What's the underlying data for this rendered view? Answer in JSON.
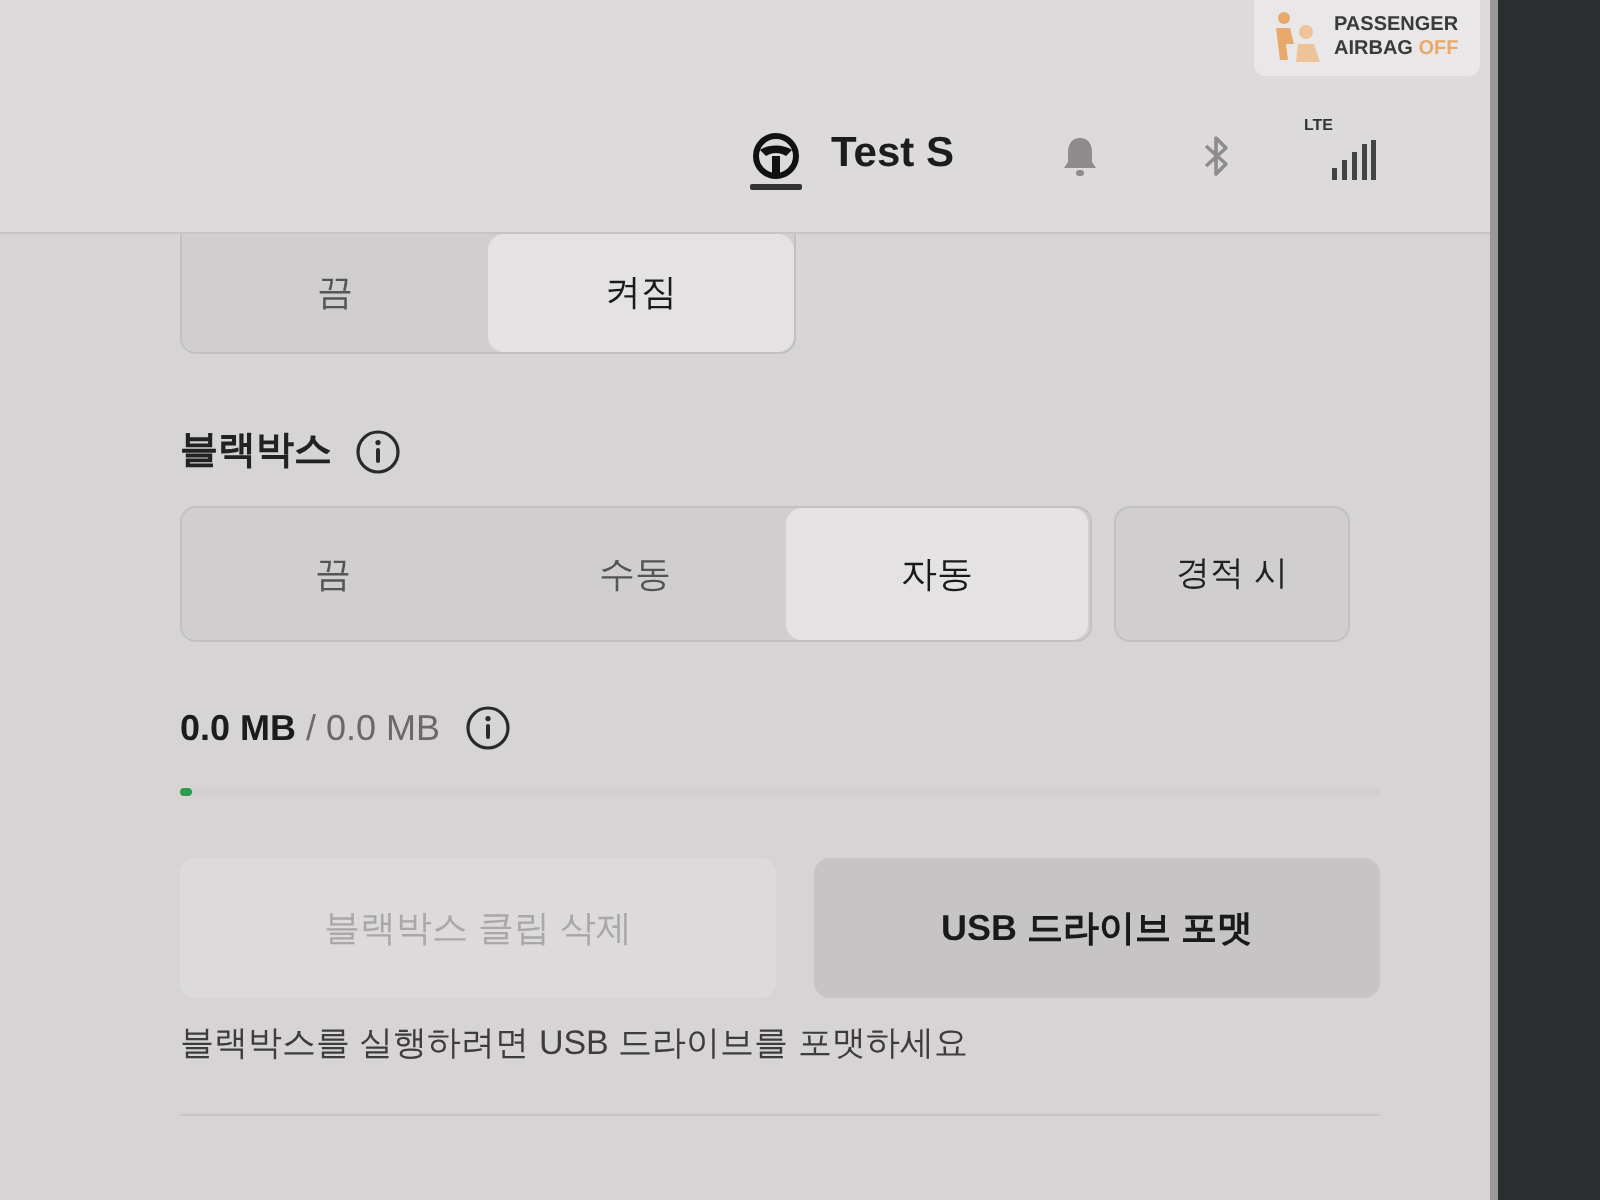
{
  "airbag_indicator": {
    "line_1": "PASSENGER",
    "line_2": "AIRBAG",
    "state": "OFF"
  },
  "header": {
    "profile_name": "Test S",
    "network": "LTE"
  },
  "top_toggle": {
    "options": [
      {
        "label": "끔",
        "selected": false
      },
      {
        "label": "켜짐",
        "selected": true
      }
    ]
  },
  "dashcam": {
    "label": "블랙박스",
    "options": [
      {
        "label": "끔",
        "selected": false
      },
      {
        "label": "수동",
        "selected": false
      },
      {
        "label": "자동",
        "selected": true
      }
    ],
    "honk_button": {
      "label": "경적 시",
      "selected": false
    }
  },
  "storage": {
    "used": "0.0 MB",
    "separator": "/",
    "total": "0.0 MB",
    "level": 0.01
  },
  "buttons": [
    {
      "label": "블랙박스 클립 삭제",
      "disabled": true
    },
    {
      "label": "USB 드라이브 포맷",
      "disabled": false
    }
  ],
  "message": "블랙박스를 실행하려면 USB 드라이브를 포맷하세요"
}
